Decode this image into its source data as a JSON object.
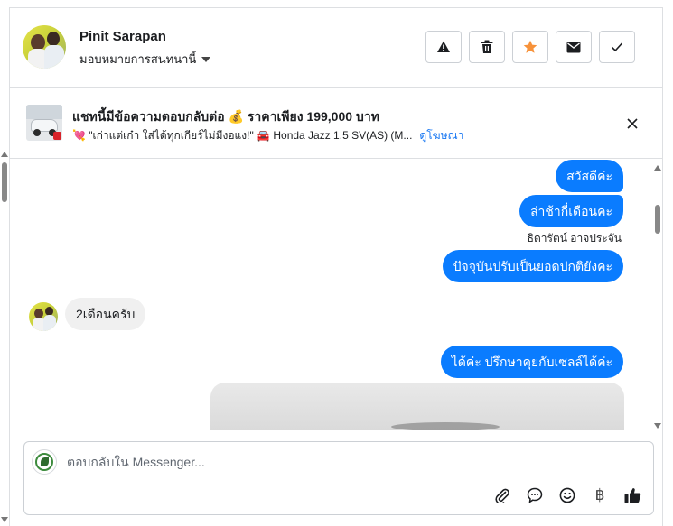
{
  "header": {
    "contact_name": "Pinit Sarapan",
    "assign_label": "มอบหมายการสนทนานี้",
    "actions": [
      {
        "name": "spam-button",
        "icon": "warning-icon"
      },
      {
        "name": "delete-button",
        "icon": "trash-icon"
      },
      {
        "name": "star-button",
        "icon": "star-icon",
        "color": "#f7923a"
      },
      {
        "name": "mark-unread-button",
        "icon": "envelope-icon"
      },
      {
        "name": "mark-done-button",
        "icon": "check-icon"
      }
    ]
  },
  "ad": {
    "title": "แชทนี้มีข้อความตอบกลับต่อ 💰 ราคาเพียง 199,000 บาท",
    "subtitle": "💘 \"เก่าแต่เก๋า ใส่ได้ทุกเกียร์ไม่มีงอแง!\" 🚘 Honda Jazz 1.5 SV(AS) (M...",
    "link": "ดูโฆษณา"
  },
  "thread": {
    "messages": [
      {
        "direction": "out",
        "text": "สวัสดีค่ะ"
      },
      {
        "direction": "out",
        "text": "ล่าช้ากี่เดือนคะ"
      },
      {
        "direction": "label",
        "text": "ธิดารัตน์ อาจประจัน"
      },
      {
        "direction": "out",
        "text": "ปัจจุบันปรับเป็นยอดปกติยังคะ"
      },
      {
        "direction": "in",
        "text": "2เดือนครับ"
      },
      {
        "direction": "out",
        "text": "ได้ค่ะ ปรึกษาคุยกับเซลล์ได้ค่ะ"
      }
    ]
  },
  "composer": {
    "placeholder": "ตอบกลับใน Messenger...",
    "tools": [
      "paperclip-icon",
      "chat-bubble-icon",
      "smiley-icon",
      "baht-icon",
      "thumbs-up-icon"
    ],
    "baht_symbol": "฿"
  },
  "colors": {
    "accent": "#0a7cff",
    "star": "#f7923a",
    "link": "#1877f2",
    "incoming_bubble": "#f0f0f0"
  }
}
